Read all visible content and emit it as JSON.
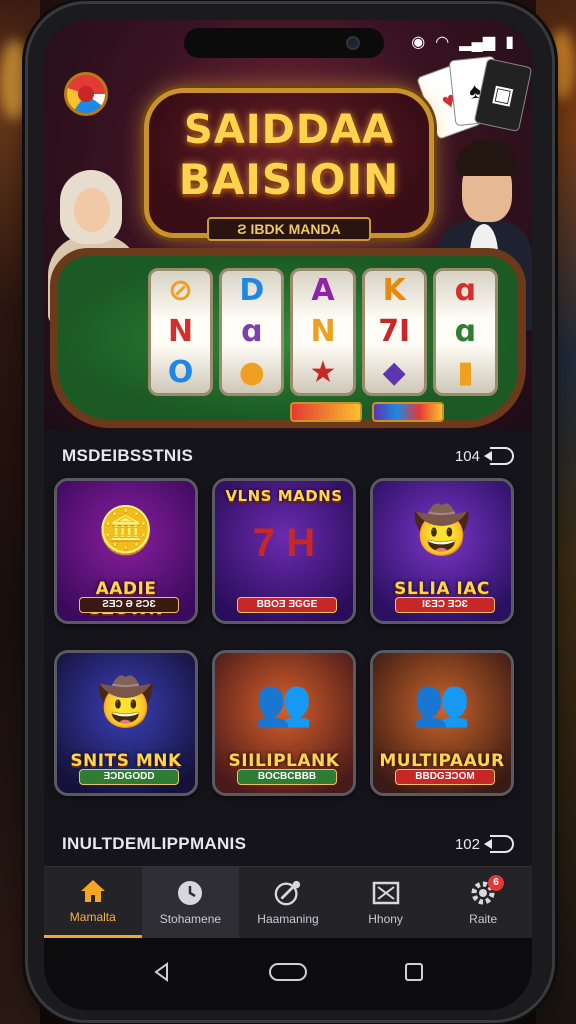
{
  "status_bar": {
    "icons": [
      "camera-icon",
      "alarm-icon",
      "wifi-icon",
      "signal-icon",
      "battery-icon"
    ]
  },
  "hero": {
    "title_line1": "SAIDDAA",
    "title_line2": "BAISIOIN",
    "subtitle": "Ƨ IBDK MANDA"
  },
  "section1": {
    "title": "MSDEIBSSTNIS",
    "count": "104",
    "games": [
      {
        "name": "AADIE SZOWN",
        "badge": "ƧƎƆ Ə ƧƆƐ",
        "colors": [
          "#8a1fa0",
          "#3b0a5c"
        ],
        "badge_color": "#3a1a10",
        "glyph": "🪙"
      },
      {
        "name": "VLNS MADNS",
        "badge": "BBOƎ ƎGGE",
        "colors": [
          "#6a2bb0",
          "#2a0d5a"
        ],
        "badge_color": "#c62828",
        "glyph": "7 H"
      },
      {
        "name": "SLLIA IAC",
        "badge": "ƖƐƎƆ ƎƆƐ",
        "colors": [
          "#7a35c8",
          "#2a1060"
        ],
        "badge_color": "#c62828",
        "glyph": "🤠"
      }
    ]
  },
  "section2": {
    "games": [
      {
        "name": "SNITS MNK",
        "badge": "ƎƆDGODD",
        "colors": [
          "#3b3fb8",
          "#14123a"
        ],
        "badge_color": "#2e7d32",
        "glyph": "🤠"
      },
      {
        "name": "SIILIPLANK",
        "badge": "BOCBCBBB",
        "colors": [
          "#d65f2a",
          "#4a1a1a"
        ],
        "badge_color": "#2e7d32",
        "glyph": "👥"
      },
      {
        "name": "MULTIPAAUR",
        "badge": "BBDGƎƆOM",
        "colors": [
          "#c8642a",
          "#3a1a14"
        ],
        "badge_color": "#c62828",
        "glyph": "👥"
      }
    ]
  },
  "section3": {
    "title": "INULTDEMLIPPMANIS",
    "count": "102"
  },
  "bottom_nav": [
    {
      "label": "Mamalta",
      "icon": "home-icon",
      "active": true
    },
    {
      "label": "Stohamene",
      "icon": "clock-icon",
      "active": false
    },
    {
      "label": "Haamaning",
      "icon": "edit-icon",
      "active": false
    },
    {
      "label": "Hhony",
      "icon": "box-icon",
      "active": false
    },
    {
      "label": "Raite",
      "icon": "settings-icon",
      "active": false,
      "badge": "6"
    }
  ],
  "system_nav": {
    "icons": [
      "back-icon",
      "home-pill-icon",
      "recents-icon"
    ]
  }
}
